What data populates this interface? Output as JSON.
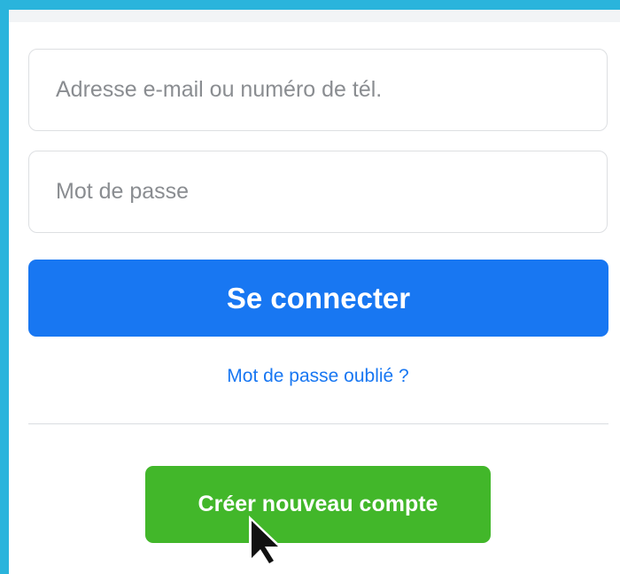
{
  "login_form": {
    "email_placeholder": "Adresse e-mail ou numéro de tél.",
    "password_placeholder": "Mot de passe",
    "login_button": "Se connecter",
    "forgot_link": "Mot de passe oublié ?",
    "create_account_button": "Créer nouveau compte"
  },
  "colors": {
    "background": "#2ab4dc",
    "primary_blue": "#1877f2",
    "create_green": "#42b72a"
  },
  "icons": {
    "pointer": "mouse-pointer-icon"
  }
}
